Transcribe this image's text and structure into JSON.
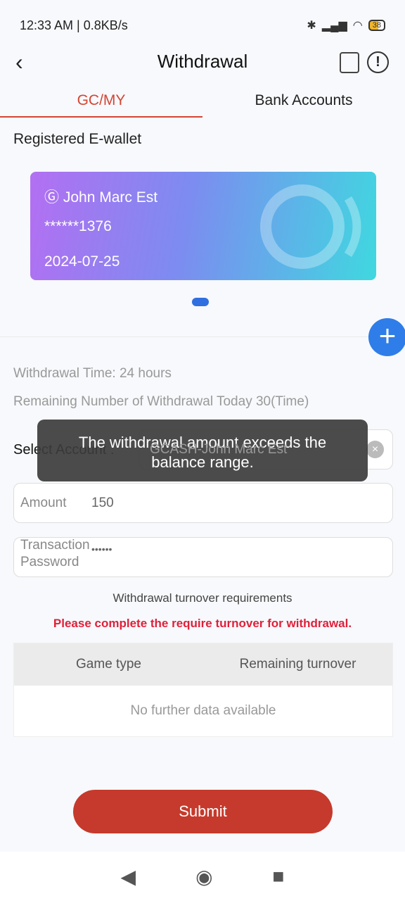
{
  "status_bar": {
    "time": "12:33 AM | 0.8KB/s",
    "battery": "38"
  },
  "header": {
    "title": "Withdrawal"
  },
  "tabs": [
    {
      "label": "GC/MY",
      "active": true
    },
    {
      "label": "Bank Accounts",
      "active": false
    }
  ],
  "wallet_section": {
    "title": "Registered E-wallet"
  },
  "card": {
    "name": "John Marc Est",
    "number": "******1376",
    "date": "2024-07-25"
  },
  "info": {
    "time": "Withdrawal Time: 24 hours",
    "remaining": "Remaining Number of Withdrawal Today 30(Time)"
  },
  "form": {
    "account_label": "Select Account :",
    "account_value": "GCASH-John Marc Est",
    "amount_label": "Amount",
    "amount_value": "150",
    "password_label_1": "Transaction",
    "password_label_2": "Password",
    "password_value": "••••••"
  },
  "toast": {
    "line1": "The withdrawal amount exceeds the",
    "line2": "balance range."
  },
  "turnover": {
    "title": "Withdrawal turnover requirements",
    "warning": "Please complete the require turnover for withdrawal.",
    "columns": [
      "Game type",
      "Remaining turnover"
    ],
    "empty": "No further data available"
  },
  "submit_label": "Submit",
  "colors": {
    "accent": "#d54534",
    "blue": "#2f7de8",
    "warning": "#e0203a"
  }
}
